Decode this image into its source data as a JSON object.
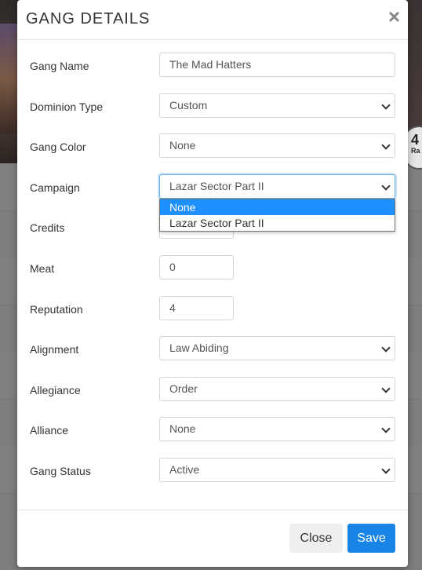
{
  "background": {
    "badge_number": "4",
    "badge_text": "Ra"
  },
  "modal": {
    "title": "GANG DETAILS",
    "close_icon": "×",
    "fields": {
      "gang_name": {
        "label": "Gang Name",
        "value": "The Mad Hatters"
      },
      "dominion_type": {
        "label": "Dominion Type",
        "value": "Custom"
      },
      "gang_color": {
        "label": "Gang Color",
        "value": "None"
      },
      "campaign": {
        "label": "Campaign",
        "value": "Lazar Sector Part II"
      },
      "credits": {
        "label": "Credits",
        "value": ""
      },
      "meat": {
        "label": "Meat",
        "value": "0"
      },
      "reputation": {
        "label": "Reputation",
        "value": "4"
      },
      "alignment": {
        "label": "Alignment",
        "value": "Law Abiding"
      },
      "allegiance": {
        "label": "Allegiance",
        "value": "Order"
      },
      "alliance": {
        "label": "Alliance",
        "value": "None"
      },
      "gang_status": {
        "label": "Gang Status",
        "value": "Active"
      }
    },
    "campaign_dropdown": {
      "options": [
        "None",
        "Lazar Sector Part II"
      ],
      "highlighted": "None"
    },
    "footer": {
      "close_label": "Close",
      "save_label": "Save"
    }
  },
  "colors": {
    "accent": "#1784e6",
    "dropdown_highlight": "#1e90ff"
  }
}
